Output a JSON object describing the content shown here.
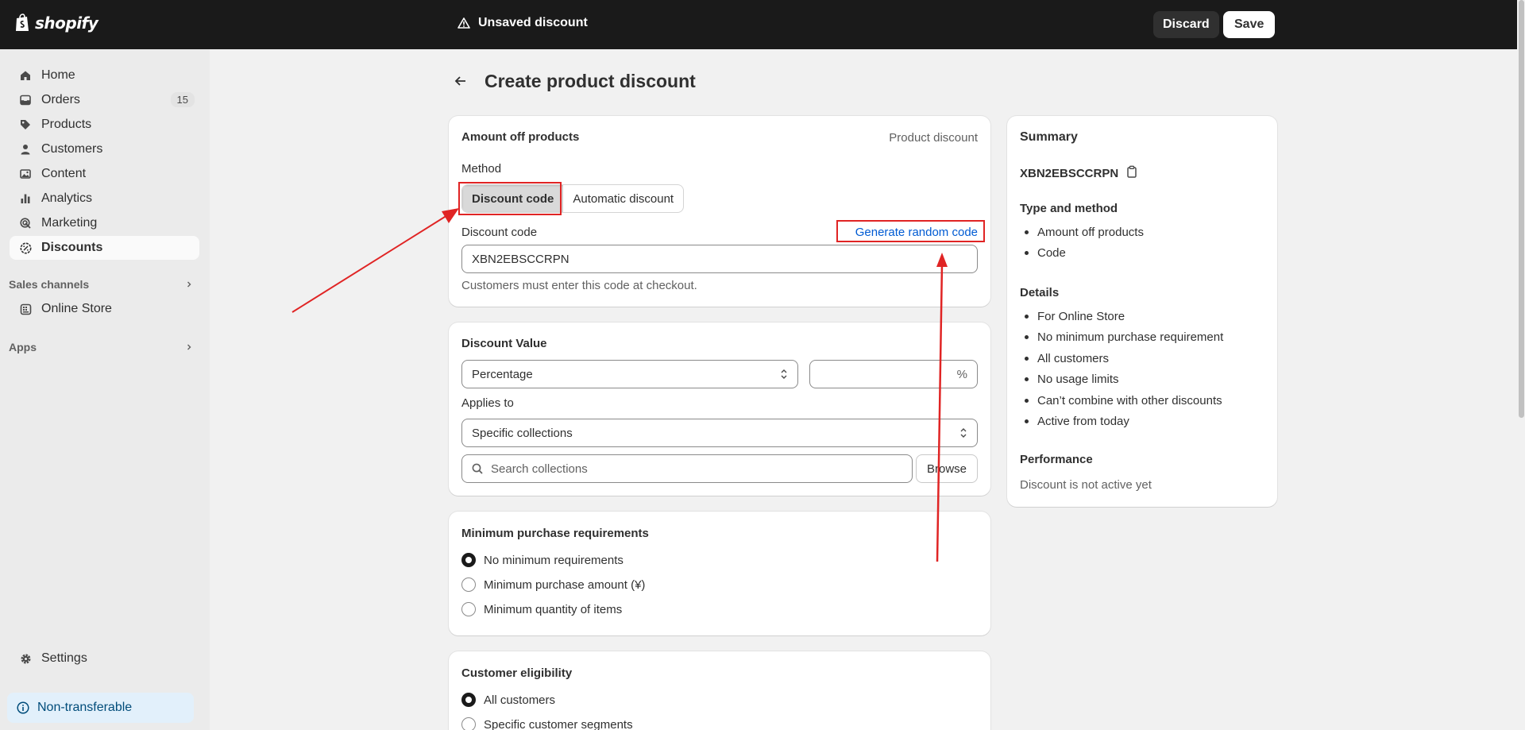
{
  "topbar": {
    "brand": "shopify",
    "status": "Unsaved discount",
    "discard_label": "Discard",
    "save_label": "Save"
  },
  "sidebar": {
    "items": [
      {
        "label": "Home",
        "icon": "home-icon"
      },
      {
        "label": "Orders",
        "icon": "orders-icon",
        "badge": "15"
      },
      {
        "label": "Products",
        "icon": "tag-icon"
      },
      {
        "label": "Customers",
        "icon": "person-icon"
      },
      {
        "label": "Content",
        "icon": "image-icon"
      },
      {
        "label": "Analytics",
        "icon": "bar-chart-icon"
      },
      {
        "label": "Marketing",
        "icon": "target-icon"
      },
      {
        "label": "Discounts",
        "icon": "discount-icon",
        "active": true
      }
    ],
    "sales_channels": "Sales channels",
    "online_store": "Online Store",
    "apps": "Apps",
    "settings": "Settings",
    "non_transferable": "Non-transferable"
  },
  "page": {
    "title": "Create product discount"
  },
  "amount_card": {
    "title": "Amount off products",
    "type": "Product discount",
    "method_label": "Method",
    "method_options": [
      "Discount code",
      "Automatic discount"
    ],
    "selected_method": "Discount code",
    "code_label": "Discount code",
    "generate_link": "Generate random code",
    "code_value": "XBN2EBSCCRPN",
    "help": "Customers must enter this code at checkout."
  },
  "value_card": {
    "title": "Discount Value",
    "value_type": "Percentage",
    "value_suffix": "%",
    "applies_label": "Applies to",
    "applies_value": "Specific collections",
    "search_placeholder": "Search collections",
    "browse_label": "Browse"
  },
  "min_card": {
    "title": "Minimum purchase requirements",
    "options": [
      "No minimum requirements",
      "Minimum purchase amount (¥)",
      "Minimum quantity of items"
    ],
    "selected": 0
  },
  "eligibility_card": {
    "title": "Customer eligibility",
    "options": [
      "All customers",
      "Specific customer segments"
    ],
    "selected": 0
  },
  "summary": {
    "title": "Summary",
    "code": "XBN2EBSCCRPN",
    "type_heading": "Type and method",
    "type_items": [
      "Amount off products",
      "Code"
    ],
    "details_heading": "Details",
    "details_items": [
      "For Online Store",
      "No minimum purchase requirement",
      "All customers",
      "No usage limits",
      "Can’t combine with other discounts",
      "Active from today"
    ],
    "performance_heading": "Performance",
    "performance_text": "Discount is not active yet"
  },
  "colors": {
    "topbar": "#1a1a1a",
    "link": "#005bd3",
    "annotation": "#e02424",
    "background": "#f1f1f1"
  }
}
